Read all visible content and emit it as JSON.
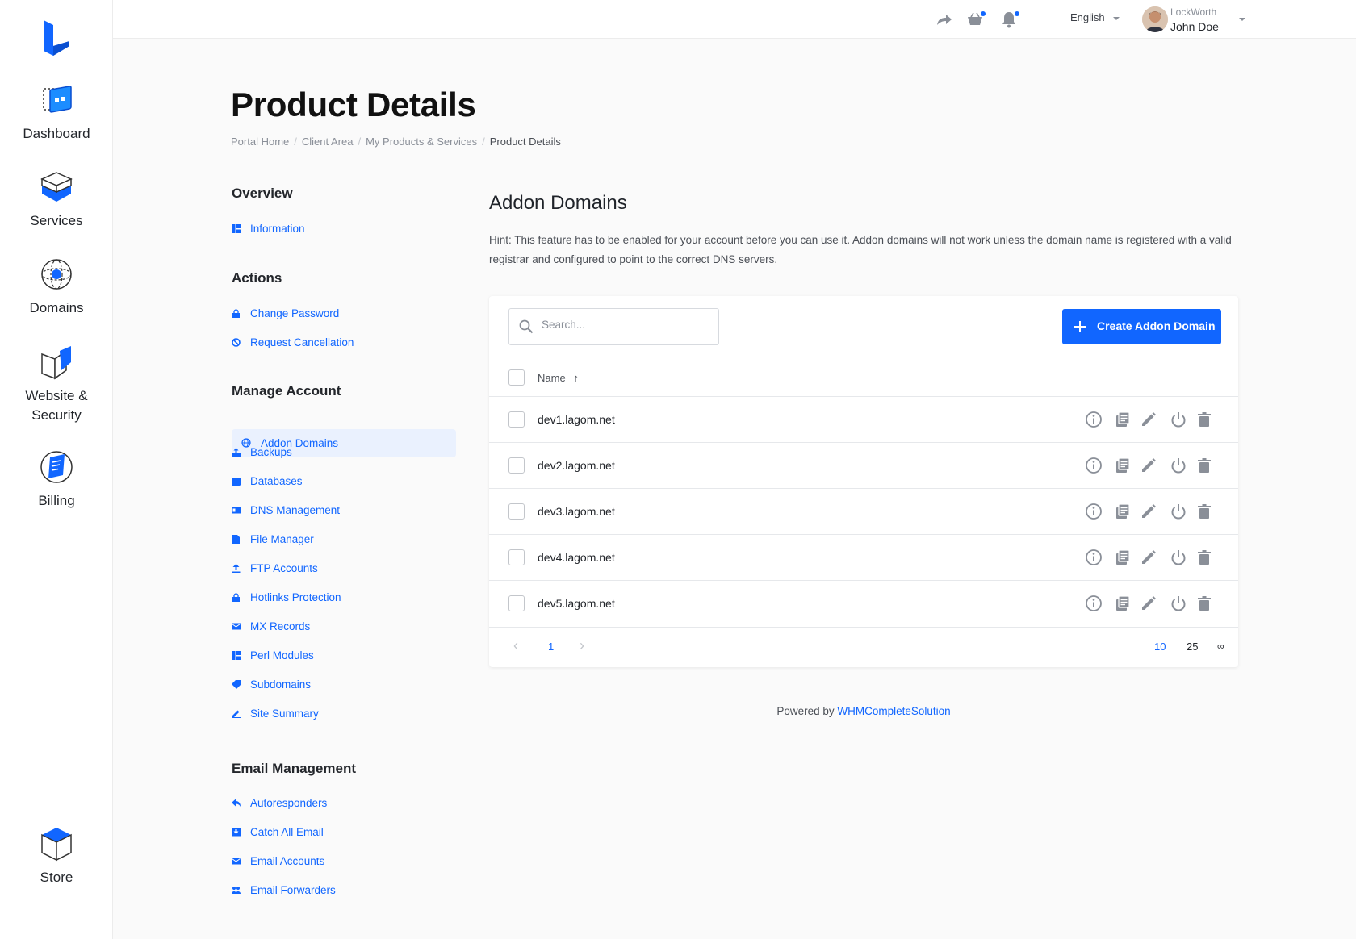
{
  "sidebar": {
    "items": [
      {
        "label": "Dashboard",
        "icon": "dashboard-icon"
      },
      {
        "label": "Services",
        "icon": "services-icon"
      },
      {
        "label": "Domains",
        "icon": "domains-icon"
      },
      {
        "label": "Website &",
        "label2": "Security",
        "icon": "website-security-icon"
      },
      {
        "label": "Billing",
        "icon": "billing-icon"
      }
    ],
    "store": {
      "label": "Store",
      "icon": "store-icon"
    }
  },
  "topbar": {
    "language": "English",
    "user": {
      "company": "LockWorth",
      "name": "John Doe"
    }
  },
  "page": {
    "title": "Product Details",
    "breadcrumb": [
      "Portal Home",
      "Client Area",
      "My Products & Services",
      "Product Details"
    ]
  },
  "side_menu": {
    "overview": {
      "title": "Overview",
      "items": [
        "Information"
      ]
    },
    "actions": {
      "title": "Actions",
      "items": [
        "Change Password",
        "Request Cancellation"
      ]
    },
    "manage": {
      "title": "Manage Account",
      "active": "Addon Domains",
      "items": [
        "Backups",
        "Databases",
        "DNS Management",
        "File Manager",
        "FTP Accounts",
        "Hotlinks Protection",
        "MX Records",
        "Perl Modules",
        "Subdomains",
        "Site Summary"
      ]
    },
    "email": {
      "title": "Email Management",
      "items": [
        "Autoresponders",
        "Catch All Email",
        "Email Accounts",
        "Email Forwarders"
      ]
    }
  },
  "main": {
    "title": "Addon Domains",
    "hint": "Hint: This feature has to be enabled for your account before you can use it. Addon domains will not work unless the domain name is registered with a valid registrar and configured to point to the correct DNS servers.",
    "search_placeholder": "Search...",
    "create_button": "Create Addon Domain",
    "column_name": "Name",
    "sort_indicator": "↑",
    "rows": [
      "dev1.lagom.net",
      "dev2.lagom.net",
      "dev3.lagom.net",
      "dev4.lagom.net",
      "dev5.lagom.net"
    ],
    "pagination": {
      "current": "1",
      "sizes": [
        "10",
        "25",
        "∞"
      ],
      "active_size": "10",
      "prev": "‹",
      "next": "›"
    }
  },
  "footer": {
    "prefix": "Powered by ",
    "link": "WHMCompleteSolution"
  },
  "colors": {
    "accent": "#1166ff",
    "active_bg": "#eaf1fe",
    "text": "#23262b"
  }
}
